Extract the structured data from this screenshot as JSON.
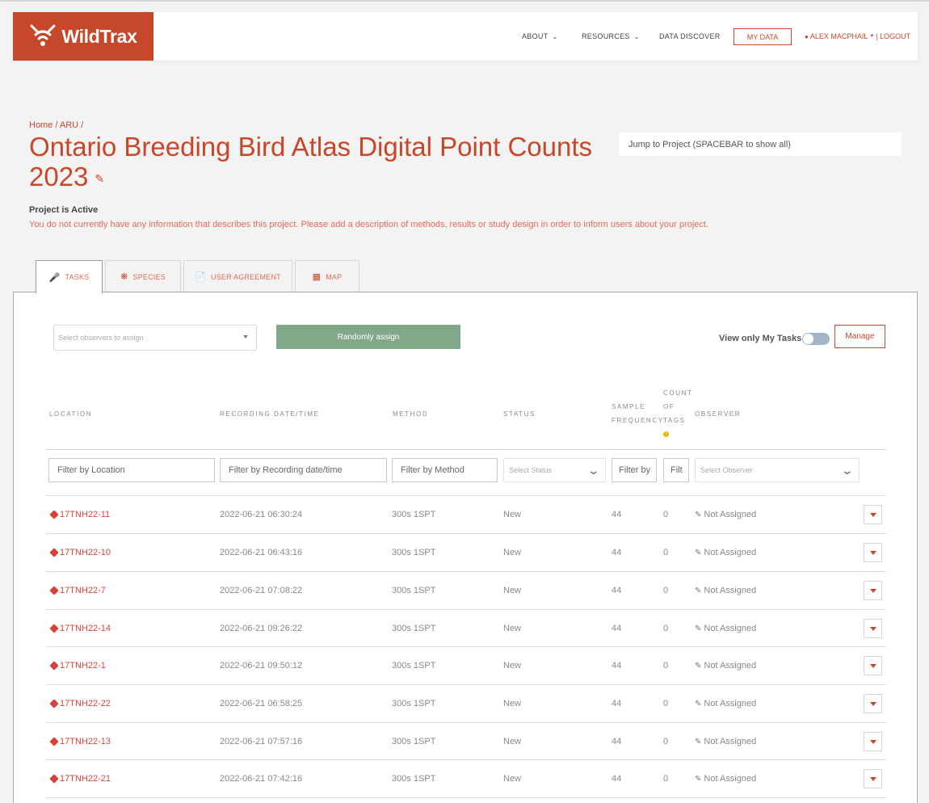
{
  "nav": {
    "logo": "WildTrax",
    "about": "ABOUT",
    "resources": "RESOURCES",
    "data_discover": "DATA DISCOVER",
    "my_data": "MY DATA",
    "user": "ALEX MACPHAIL",
    "logout": "| LOGOUT"
  },
  "breadcrumb": {
    "home": "Home",
    "sep1": " / ",
    "aru": "ARU",
    "sep2": " /"
  },
  "project": {
    "title": "Ontario Breeding Bird Atlas Digital Point Counts 2023",
    "status": "Project is Active",
    "description": "You do not currently have any information that describes this project. Please add a description of methods, results or study design in order to inform users about your project."
  },
  "jump": {
    "placeholder": "Jump to Project (SPACEBAR to show all)"
  },
  "tabs": [
    {
      "label": "TASKS",
      "icon": "microphone-icon"
    },
    {
      "label": "SPECIES",
      "icon": "paw-icon"
    },
    {
      "label": "USER AGREEMENT",
      "icon": "document-icon"
    },
    {
      "label": "MAP",
      "icon": "map-icon"
    }
  ],
  "controls": {
    "observers_placeholder": "Select observers to assign",
    "random_assign": "Randomly assign",
    "view_only_mine": "View only My Tasks",
    "manage": "Manage"
  },
  "table": {
    "headers": {
      "location": "LOCATION",
      "recording": "RECORDING DATE/TIME",
      "method": "METHOD",
      "status": "STATUS",
      "sample1": "SAMPLE",
      "sample2": "FREQUENCY",
      "count1": "COUNT",
      "count2": "OF",
      "count3": "TAGS",
      "observer": "OBSERVER"
    },
    "filters": {
      "location": "Filter by Location",
      "recording": "Filter by Recording date/time",
      "method": "Filter by Method",
      "status": "Select Status",
      "sample": "Filter by",
      "count": "Filt",
      "observer": "Select Observer"
    },
    "rows": [
      {
        "location": "17TNH22-11",
        "datetime": "2022-06-21 06:30:24",
        "method": "300s 1SPT",
        "status": "New",
        "freq": "44",
        "count": "0",
        "observer": "Not Assigned"
      },
      {
        "location": "17TNH22-10",
        "datetime": "2022-06-21 06:43:16",
        "method": "300s 1SPT",
        "status": "New",
        "freq": "44",
        "count": "0",
        "observer": "Not Assigned"
      },
      {
        "location": "17TNH22-7",
        "datetime": "2022-06-21 07:08:22",
        "method": "300s 1SPT",
        "status": "New",
        "freq": "44",
        "count": "0",
        "observer": "Not Assigned"
      },
      {
        "location": "17TNH22-14",
        "datetime": "2022-06-21 09:26:22",
        "method": "300s 1SPT",
        "status": "New",
        "freq": "44",
        "count": "0",
        "observer": "Not Assigned"
      },
      {
        "location": "17TNH22-1",
        "datetime": "2022-06-21 09:50:12",
        "method": "300s 1SPT",
        "status": "New",
        "freq": "44",
        "count": "0",
        "observer": "Not Assigned"
      },
      {
        "location": "17TNH22-22",
        "datetime": "2022-06-21 06:58:25",
        "method": "300s 1SPT",
        "status": "New",
        "freq": "44",
        "count": "0",
        "observer": "Not Assigned"
      },
      {
        "location": "17TNH22-13",
        "datetime": "2022-06-21 07:57:16",
        "method": "300s 1SPT",
        "status": "New",
        "freq": "44",
        "count": "0",
        "observer": "Not Assigned"
      },
      {
        "location": "17TNH22-21",
        "datetime": "2022-06-21 07:42:16",
        "method": "300s 1SPT",
        "status": "New",
        "freq": "44",
        "count": "0",
        "observer": "Not Assigned"
      }
    ]
  },
  "colors": {
    "brand": "#c7472a",
    "link": "#d9413b",
    "assign_button": "#82a88a"
  }
}
